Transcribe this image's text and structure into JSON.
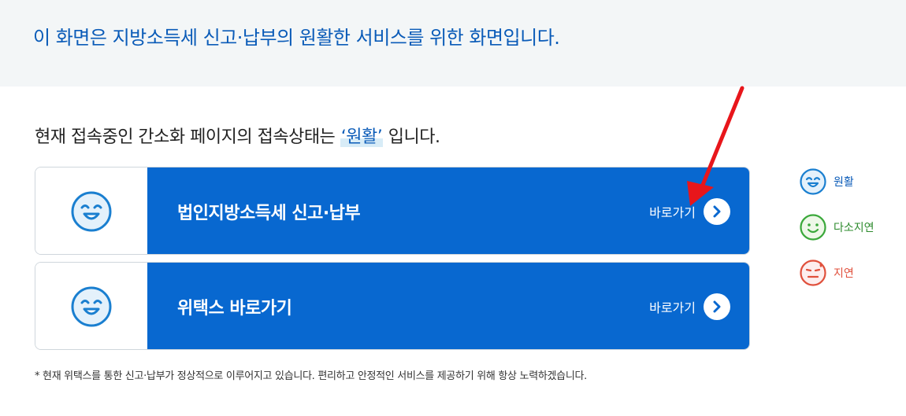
{
  "banner": {
    "text": "이 화면은 지방소득세 신고·납부의 원활한 서비스를 위한 화면입니다."
  },
  "status": {
    "prefix": "현재 접속중인 간소화 페이지의 접속상태는 ",
    "value": "‘원활’",
    "suffix": " 입니다."
  },
  "cards": [
    {
      "title": "법인지방소득세 신고·납부",
      "go_label": "바로가기",
      "status_icon": "smile-face-icon"
    },
    {
      "title": "위택스 바로가기",
      "go_label": "바로가기",
      "status_icon": "smile-face-icon"
    }
  ],
  "legend": {
    "smooth": {
      "label": "원활",
      "color": "#0a5bb8"
    },
    "delayed_some": {
      "label": "다소지연",
      "color": "#2e8b2e"
    },
    "delayed": {
      "label": "지연",
      "color": "#e0503c"
    }
  },
  "note": "* 현재 위택스를 통한 신고·납부가 정상적으로 이루어지고 있습니다. 편리하고 안정적인 서비스를 제공하기 위해 항상 노력하겠습니다.",
  "colors": {
    "brand_blue": "#0868d0",
    "annotation_arrow": "#e8161b"
  }
}
